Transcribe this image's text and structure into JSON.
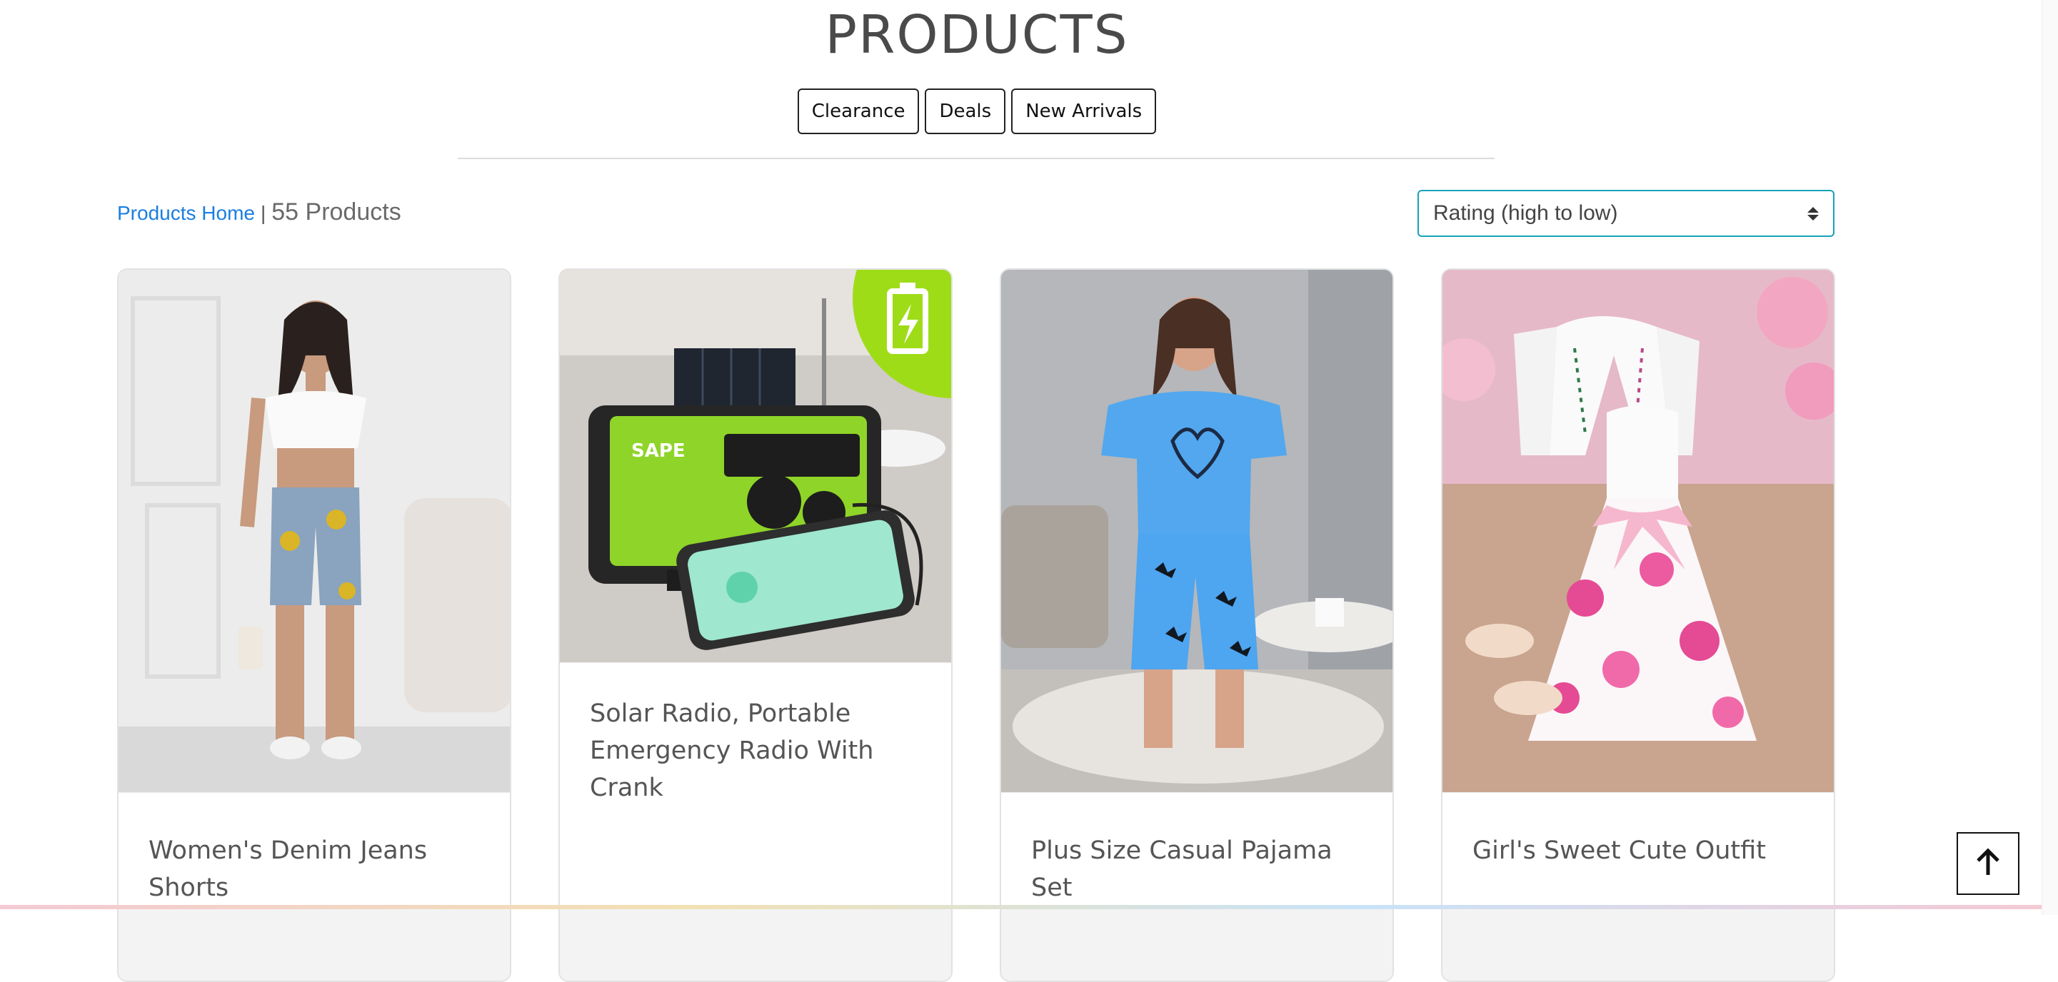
{
  "page": {
    "title": "PRODUCTS"
  },
  "filters": [
    {
      "label": "Clearance"
    },
    {
      "label": "Deals"
    },
    {
      "label": "New Arrivals"
    }
  ],
  "breadcrumb": {
    "home_label": "Products Home",
    "separator": "|",
    "count": "55 Products"
  },
  "sort": {
    "selected": "Rating (high to low)"
  },
  "products": [
    {
      "title": "Women's Denim Jeans Shorts",
      "image": "woman-denim-shorts-photo"
    },
    {
      "title": "Solar Radio, Portable Emergency Radio With Crank",
      "image": "green-solar-radio-photo"
    },
    {
      "title": "Plus Size Casual Pajama Set",
      "image": "blue-butterfly-pajama-photo"
    },
    {
      "title": "Girl's Sweet Cute Outfit",
      "image": "girls-floral-dress-photo"
    }
  ],
  "icons": {
    "scroll_top": "arrow-up-icon",
    "sort": "sort-arrows-icon"
  },
  "colors": {
    "accent": "#17a2b8",
    "link": "#1a7ee0",
    "radio_green": "#8fd428"
  }
}
